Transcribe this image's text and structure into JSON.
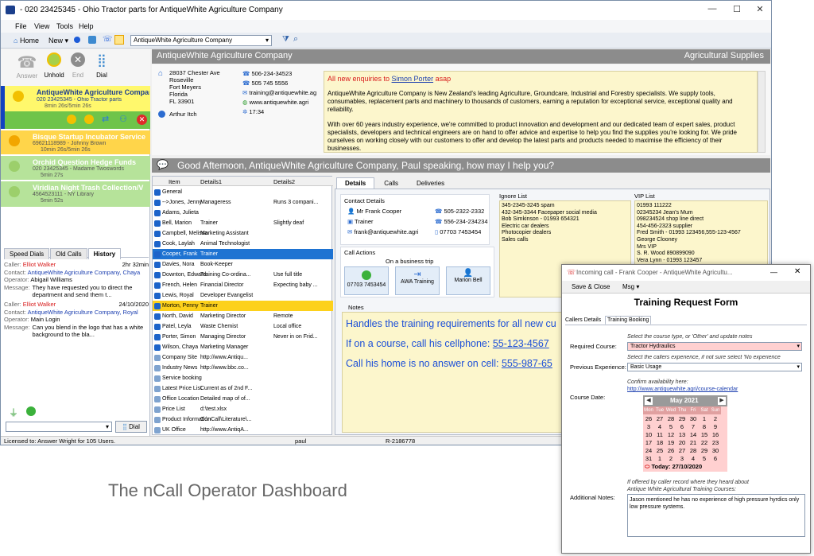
{
  "window": {
    "title": "- 020 23425345 - Ohio Tractor parts for AntiqueWhite Agriculture Company",
    "minimize": "—",
    "maximize": "☐",
    "close": "✕"
  },
  "menu": [
    {
      "label": "File"
    },
    {
      "label": "View"
    },
    {
      "label": "Tools"
    },
    {
      "label": "Help"
    }
  ],
  "toolbar": {
    "home": "Home",
    "new": "New",
    "company_combo": "AntiqueWhite Agriculture Company"
  },
  "call_controls": [
    {
      "label": "Answer"
    },
    {
      "label": "Unhold"
    },
    {
      "label": "End"
    },
    {
      "label": "Dial"
    }
  ],
  "calls": [
    {
      "title": "AntiqueWhite Agriculture Compar",
      "line": "020 23425345 - Ohio Tractor parts",
      "time": "8min 26s/5min 26s"
    },
    {
      "title": "Bisque Startup Incubator Service",
      "line": "69621118989 - Johnny Brown",
      "time": "10min 26s/5min 26s"
    },
    {
      "title": "Orchid Question Hedge Funds",
      "line": "020 23425345 - Madame Twoswords",
      "time": "5min 27s"
    },
    {
      "title": "Viridian Night Trash Collection/V",
      "line": "4564523111 - NY Library",
      "time": "5min 52s"
    }
  ],
  "left_tabs": [
    {
      "label": "Speed Dials"
    },
    {
      "label": "Old Calls"
    },
    {
      "label": "History"
    }
  ],
  "history": [
    {
      "caller_label": "Caller:",
      "caller": "Elliot Walker",
      "when": "2hr 32min",
      "contact_label": "Contact:",
      "contact": "AntiqueWhite Agriculture Company, Chaya",
      "operator_label": "Operator:",
      "operator": "Abigail Williams",
      "message_label": "Message:",
      "message": "They have requested you to direct the department and send them t..."
    },
    {
      "caller_label": "Caller:",
      "caller": "Elliot Walker",
      "when": "24/10/2020",
      "contact_label": "Contact:",
      "contact": "AntiqueWhite Agriculture Company, Royal",
      "operator_label": "Operator:",
      "operator": "Main Login",
      "message_label": "Message:",
      "message": "Can you blend in the logo that has a white background to the bla..."
    }
  ],
  "dial_button": "Dial",
  "company": {
    "name": "AntiqueWhite Agriculture Company",
    "category": "Agricultural Supplies",
    "address": [
      "28037 Chester Ave",
      "Roseville",
      "Fort Meyers",
      "Florida",
      "FL 33901"
    ],
    "contact_person": "Arthur Itch",
    "phone1": "506-234-34523",
    "phone2": "505 745 5556",
    "email": "training@antiquewhite.ag",
    "web": "www.antiquewhite.agri",
    "time": "17:34",
    "notice_prefix": "All new enquiries to ",
    "notice_name": "Simon Porter",
    "notice_suffix": " asap",
    "description1": "AntiqueWhite Agriculture Company is New Zealand's leading Agriculture, Groundcare, Industrial and Forestry specialists. We supply tools, consumables, replacement parts and machinery to thousands of customers, earning a reputation for exceptional service, exceptional quality and reliability.",
    "description2": "With over 60 years industry experience, we're committed to product innovation and development and our dedicated team of expert sales, product specialists, developers and technical engineers are on hand to offer advice and expertise to help you find the supplies you're looking for. We pride ourselves on working closely with our customers to offer and develop the latest parts and products needed to maximise the efficiency of their businesses."
  },
  "greeting": "Good Afternoon, AntiqueWhite Agriculture Company,  Paul  speaking, how may I help you?",
  "list_headers": {
    "item": "Item",
    "d1": "Details1",
    "d2": "Details2"
  },
  "list_rows": [
    {
      "item": "General",
      "d1": "",
      "d2": ""
    },
    {
      "item": "-->Jones, Jenny",
      "d1": "Manageress",
      "d2": "Runs 3 compani..."
    },
    {
      "item": "Adams, Julieta",
      "d1": "",
      "d2": ""
    },
    {
      "item": "Bell, Marion",
      "d1": "Trainer",
      "d2": "Slightly deaf"
    },
    {
      "item": "Campbell, Melissa",
      "d1": "Marketing Assistant",
      "d2": ""
    },
    {
      "item": "Cook, Laylah",
      "d1": "Animal Technologist",
      "d2": ""
    },
    {
      "item": "Cooper, Frank",
      "d1": "Trainer",
      "d2": ""
    },
    {
      "item": "Davies, Nora",
      "d1": "Book-Keeper",
      "d2": ""
    },
    {
      "item": "Downton, Edward",
      "d1": "Training Co-ordina...",
      "d2": "Use full title"
    },
    {
      "item": "French, Helen",
      "d1": "Financial Director",
      "d2": "Expecting baby ..."
    },
    {
      "item": "Lewis, Royal",
      "d1": "Developer Evangelist",
      "d2": ""
    },
    {
      "item": "Morton, Penny",
      "d1": "Trainer",
      "d2": ""
    },
    {
      "item": "North, David",
      "d1": "Marketing Director",
      "d2": "Remote"
    },
    {
      "item": "Patel, Leyla",
      "d1": "Waste Chemist",
      "d2": "Local office"
    },
    {
      "item": "Porter, Simon",
      "d1": "Managing Director",
      "d2": "Never in on Frid..."
    },
    {
      "item": "Wilson, Chaya",
      "d1": "Marketing Manager",
      "d2": ""
    },
    {
      "item": "Company Site",
      "d1": "http://www.Antiqu...",
      "d2": ""
    },
    {
      "item": "Industry News",
      "d1": "http://www.bbc.co...",
      "d2": ""
    },
    {
      "item": "Service booking",
      "d1": "",
      "d2": ""
    },
    {
      "item": "Latest Price List",
      "d1": "Current as of 2nd F...",
      "d2": ""
    },
    {
      "item": "Office Location",
      "d1": "Detailed map of of...",
      "d2": ""
    },
    {
      "item": "Price List",
      "d1": "d:\\test.xlsx",
      "d2": ""
    },
    {
      "item": "Product Information",
      "d1": "O:\\nCall\\Literature\\...",
      "d2": ""
    },
    {
      "item": "UK Office",
      "d1": "http://www.AntiqA...",
      "d2": ""
    }
  ],
  "detail_tabs": [
    {
      "label": "Details"
    },
    {
      "label": "Calls"
    },
    {
      "label": "Deliveries"
    }
  ],
  "contact_details": {
    "heading": "Contact Details",
    "name": "Mr Frank Cooper",
    "role": "Trainer",
    "email": "frank@antiquewhite.agri",
    "phone1": "505-2322-2332",
    "phone2": "556-234-234234",
    "mobile": "07703 7453454"
  },
  "ignore_list": {
    "heading": "Ignore List",
    "entries": [
      "345-2345-3245 spam",
      "432-345-3344 Facepaper social media",
      "Bob Simkinson - 01993 654321",
      "Electric car dealers",
      "Photocopier dealers",
      "Sales calls"
    ]
  },
  "vip_list": {
    "heading": "VIP List",
    "entries": [
      "01993 111222",
      "02345234 Jean's Mum",
      "098234524 shop line direct",
      "454-456-2323 supplier",
      "Fred Smith - 01993 123456,555-123-4567",
      "George Clooney",
      "Mrs VIP",
      "S. R. Wood 890899090",
      "Vera Lynn - 01993 123457"
    ]
  },
  "call_actions": {
    "heading": "Call Actions",
    "status": "On a business trip",
    "buttons": [
      {
        "label": "07703 7453454"
      },
      {
        "label": "AWA Training"
      },
      {
        "label": "Marion Bell"
      }
    ]
  },
  "notes": {
    "heading": "Notes",
    "line1": "Handles the training requirements for all new cu",
    "line2_prefix": "If on a course, call his cellphone:  ",
    "line2_num": "55-123-4567",
    "line3_prefix": "Call his home is no answer on cell:  ",
    "line3_num": "555-987-65"
  },
  "status_bar": {
    "license": "Licensed to: Answer Wright for 105 Users.",
    "user": "paul",
    "ref": "R-2186778"
  },
  "caption": "The nCall Operator Dashboard",
  "dialog": {
    "title": "Incoming call - Frank Cooper - AntiqueWhite Agricultu...",
    "save": "Save & Close",
    "msg": "Msg",
    "heading": "Training Request Form",
    "tabs": [
      {
        "label": "Callers Details"
      },
      {
        "label": "Training Booking"
      }
    ],
    "course_hint": "Select the course type, or 'Other' and update notes",
    "course_label": "Required Course:",
    "course_value": "Tractor Hydraulics",
    "exp_hint": "Select the callers experience, if not sure select 'No experience",
    "exp_label": "Previous Experience:",
    "exp_value": "Basic Usage",
    "confirm_hint": "Confirm availability here:",
    "confirm_link": "http://www.antiquewhite.agri/course-calendar",
    "date_label": "Course Date:",
    "month": "May 2021",
    "weekdays": [
      "Mon",
      "Tue",
      "Wed",
      "Thu",
      "Fri",
      "Sat",
      "Sun"
    ],
    "weeks": [
      [
        "26",
        "27",
        "28",
        "29",
        "30",
        "1",
        "2"
      ],
      [
        "3",
        "4",
        "5",
        "6",
        "7",
        "8",
        "9"
      ],
      [
        "10",
        "11",
        "12",
        "13",
        "14",
        "15",
        "16"
      ],
      [
        "17",
        "18",
        "19",
        "20",
        "21",
        "22",
        "23"
      ],
      [
        "24",
        "25",
        "26",
        "27",
        "28",
        "29",
        "30"
      ],
      [
        "31",
        "1",
        "2",
        "3",
        "4",
        "5",
        "6"
      ]
    ],
    "today": "Today: 27/10/2020",
    "notes_hint1": "If offered by caller record where they heard about",
    "notes_hint2": "Antique White Agricultural Training Courses:",
    "notes_label": "Additional Notes:",
    "notes_value": "Jason mentioned he has no experience of high pressure hyrdics only low pressure systems."
  }
}
